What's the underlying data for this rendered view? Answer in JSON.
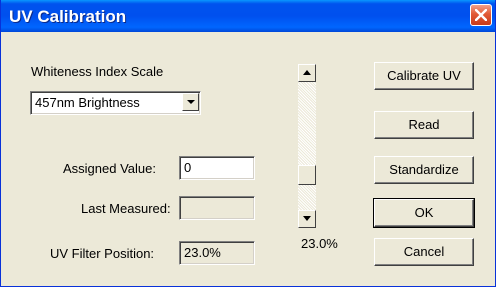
{
  "window": {
    "title": "UV Calibration"
  },
  "scale": {
    "label": "Whiteness Index Scale",
    "selected": "457nm Brightness"
  },
  "fields": {
    "assigned_label": "Assigned Value:",
    "assigned_value": "0",
    "last_measured_label": "Last Measured:",
    "last_measured_value": "",
    "uv_filter_label": "UV Filter Position:",
    "uv_filter_value": "23.0%"
  },
  "slider": {
    "value_text": "23.0%",
    "position_fraction": 0.77
  },
  "buttons": {
    "calibrate": "Calibrate UV",
    "read": "Read",
    "standardize": "Standardize",
    "ok": "OK",
    "cancel": "Cancel"
  },
  "icons": [
    "close-icon",
    "chevron-down-icon",
    "scroll-up-arrow-icon",
    "scroll-down-arrow-icon"
  ]
}
